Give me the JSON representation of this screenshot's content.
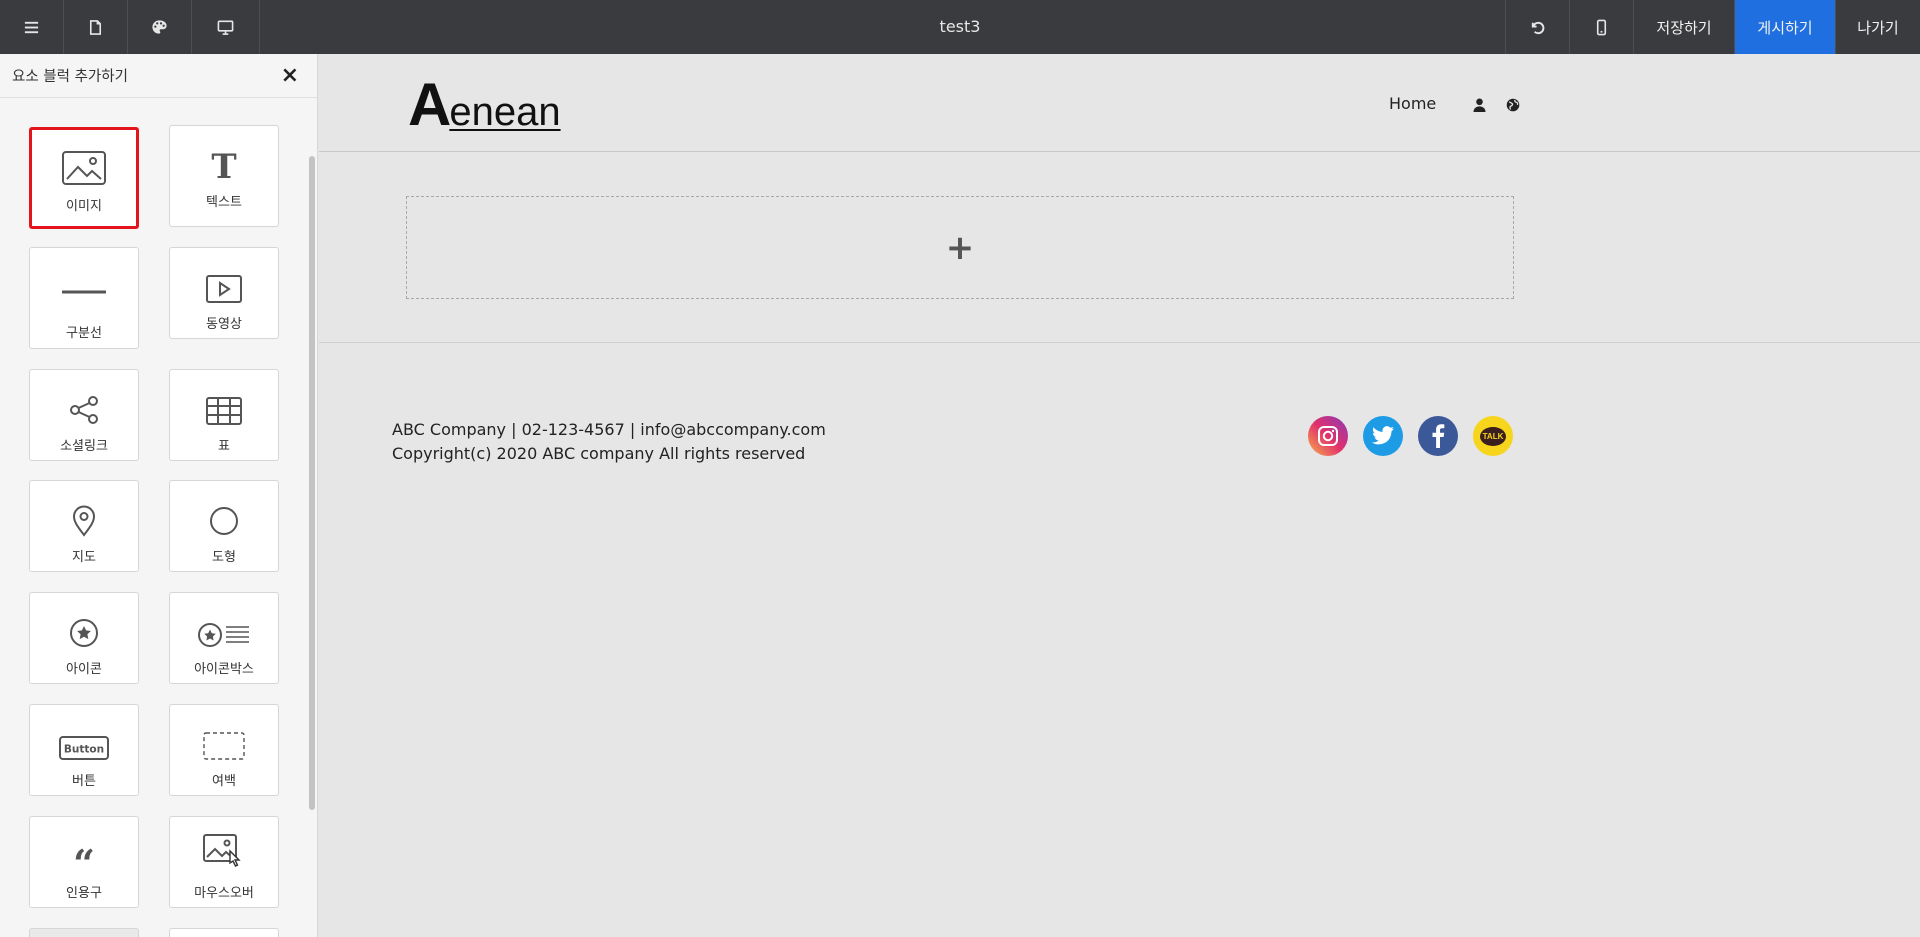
{
  "topbar": {
    "title": "test3",
    "left_buttons": [
      "menu-icon",
      "page-icon",
      "palette-icon",
      "desktop-icon"
    ],
    "undo_icon": "undo-icon",
    "mobile_icon": "mobile-icon",
    "save_label": "저장하기",
    "publish_label": "게시하기",
    "exit_label": "나가기",
    "publish_color": "#1f6fe0"
  },
  "panel": {
    "title": "요소 블럭 추가하기",
    "close_icon": "×",
    "tiles": [
      {
        "label": "이미지",
        "icon": "image-icon",
        "selected": true
      },
      {
        "label": "텍스트",
        "icon": "text-icon"
      },
      {
        "label": "구분선",
        "icon": "divider-icon"
      },
      {
        "label": "동영상",
        "icon": "video-icon"
      },
      {
        "label": "소셜링크",
        "icon": "share-icon"
      },
      {
        "label": "표",
        "icon": "table-icon"
      },
      {
        "label": "지도",
        "icon": "map-pin-icon"
      },
      {
        "label": "도형",
        "icon": "circle-icon"
      },
      {
        "label": "아이콘",
        "icon": "star-circle-icon"
      },
      {
        "label": "아이콘박스",
        "icon": "iconbox-icon"
      },
      {
        "label": "버튼",
        "icon": "button-icon",
        "icon_text": "Button"
      },
      {
        "label": "여백",
        "icon": "spacer-icon"
      },
      {
        "label": "인용구",
        "icon": "quote-icon"
      },
      {
        "label": "마우스오버",
        "icon": "hover-image-icon"
      }
    ]
  },
  "site": {
    "logo_first": "A",
    "logo_rest": "enean",
    "nav_home": "Home",
    "drop_plus": "+",
    "footer_line1": "ABC Company | 02-123-4567 | info@abccompany.com",
    "footer_line2": "Copyright(c) 2020 ABC company All rights reserved",
    "social": [
      "instagram-icon",
      "twitter-icon",
      "facebook-icon",
      "kakaotalk-icon"
    ],
    "kakao_text": "TALK"
  }
}
